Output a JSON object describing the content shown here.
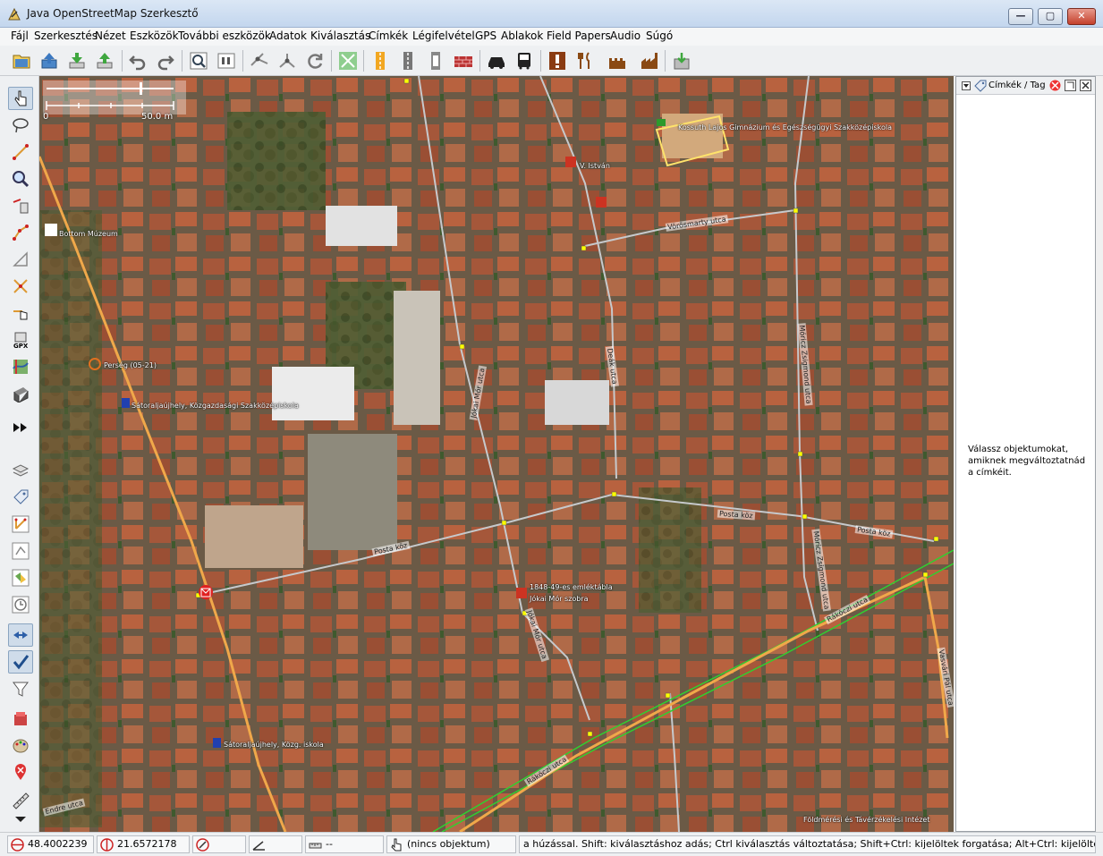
{
  "window": {
    "title": "Java OpenStreetMap Szerkesztő"
  },
  "menu": [
    "Fájl",
    "Szerkesztés",
    "Nézet",
    "Eszközök",
    "További eszközök",
    "Adatok",
    "Kiválasztás",
    "Címkék",
    "Légifelvétel",
    "GPS",
    "Ablakok",
    "Field Papers",
    "Audio",
    "Súgó"
  ],
  "toolbar_icons": [
    "open-file-icon",
    "upload-icon",
    "download-icon",
    "upload-data-icon",
    "undo-icon",
    "redo-icon",
    "zoom-preview-icon",
    "properties-icon",
    "split-way-icon",
    "combine-icon",
    "refresh-icon",
    "align-icon",
    "road-yellow-preset-icon",
    "road-grey-preset-icon",
    "road-white-preset-icon",
    "wall-preset-icon",
    "car-preset-icon",
    "bus-preset-icon",
    "warning-preset-icon",
    "restaurant-preset-icon",
    "castle-preset-icon",
    "industry-preset-icon",
    "export-icon"
  ],
  "left_tools": [
    "select-tool-icon",
    "lasso-tool-icon",
    "draw-tool-icon",
    "zoom-tool-icon",
    "delete-tool-icon",
    "parallel-tool-icon",
    "improve-way-icon",
    "split-tool-icon",
    "extrude-tool-icon",
    "gpx-tool-icon",
    "imagery-tool-icon",
    "grid-tool-icon",
    "more-tools-icon",
    "layers-icon",
    "tags-icon",
    "relation-icon",
    "selection-list-icon",
    "conflict-icon",
    "history-icon",
    "filter-icon",
    "validator-icon",
    "gear-icon",
    "chevron-down-icon"
  ],
  "scale": {
    "left_label": "0",
    "right_label": "50.0 m"
  },
  "map_labels": {
    "school": "Kossuth Lajos Gimnázium és Egészségügyi Szakközépiskola",
    "monument": "V. István",
    "museum": "Bottom Múzeum",
    "bakery": "Perség (05-21)",
    "bus_stop_1": "Sátoraljaújhely, Közgazdasági Szakközépiskola",
    "memorial": "1848-49-es emléktábla",
    "statue": "Jókai Mór szobra",
    "bus_stop_2": "Sátoraljaújhely, Közg. iskola",
    "attribution": "Földmérési és Távérzékelési Intézet"
  },
  "street_labels": {
    "vorosmarty": "Vörösmarty utca",
    "deak": "Deák utca",
    "moricz1": "Móricz Zsigmond utca",
    "jokai1": "Jókai Mór utca",
    "posta1": "Posta köz",
    "posta2": "Posta köz",
    "posta3": "Posta köz",
    "moricz2": "Móricz Zsigmond utca",
    "jokai2": "Jókai Mór utca",
    "rakoczi1": "Rákóczi utca",
    "rakoczi2": "Rákóczi utca",
    "vasvari": "Vasvári Pál utca",
    "endre": "Endre utca"
  },
  "right_panel": {
    "title": "Címkék / Tag",
    "hint": "Válassz objektumokat, amiknek megváltoztatnád a címkéit."
  },
  "status": {
    "lat": "48.4002239",
    "lon": "21.6572178",
    "heading": "",
    "angle": "",
    "distance": "--",
    "object": "(nincs objektum)",
    "help": "a húzással. Shift: kiválasztáshoz adás; Ctrl kiválasztás változtatása; Shift+Ctrl: kijelöltek forgatása; Alt+Ctrl: kijelöltek átméretezése"
  },
  "colors": {
    "map_bg": "#7d6e58",
    "road_orange": "#f0a84a",
    "road_grey": "#c6c9cc",
    "node_yellow": "#ffff00",
    "route_green": "#30d030"
  }
}
